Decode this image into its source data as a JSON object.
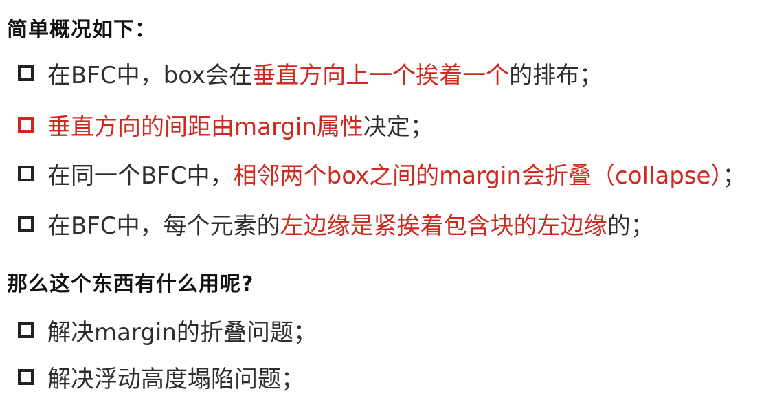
{
  "heading1": "简单概况如下：",
  "heading2": "那么这个东西有什么用呢?",
  "colors": {
    "emphasis": "#d0281e",
    "text": "#2e2e2e",
    "bullet": "#222222"
  },
  "items": [
    {
      "bullet_color": "black",
      "segments": [
        {
          "text": "在BFC中，box会在",
          "highlight": false
        },
        {
          "text": "垂直方向上一个挨着一个",
          "highlight": true
        },
        {
          "text": "的排布；",
          "highlight": false
        }
      ]
    },
    {
      "bullet_color": "red",
      "segments": [
        {
          "text": "垂直方向的间距由margin属性",
          "highlight": true
        },
        {
          "text": "决定；",
          "highlight": false
        }
      ]
    },
    {
      "bullet_color": "black",
      "segments": [
        {
          "text": "在同一个BFC中，",
          "highlight": false
        },
        {
          "text": "相邻两个box之间的margin会折叠（collapse）",
          "highlight": true
        },
        {
          "text": "；",
          "highlight": false
        }
      ]
    },
    {
      "bullet_color": "black",
      "segments": [
        {
          "text": "在BFC中，每个元素的",
          "highlight": false
        },
        {
          "text": "左边缘是紧挨着包含块的左边缘",
          "highlight": true
        },
        {
          "text": "的；",
          "highlight": false
        }
      ]
    },
    {
      "bullet_color": "black",
      "segments": [
        {
          "text": "解决margin的折叠问题；",
          "highlight": false
        }
      ]
    },
    {
      "bullet_color": "black",
      "segments": [
        {
          "text": "解决浮动高度塌陷问题；",
          "highlight": false
        }
      ]
    }
  ]
}
